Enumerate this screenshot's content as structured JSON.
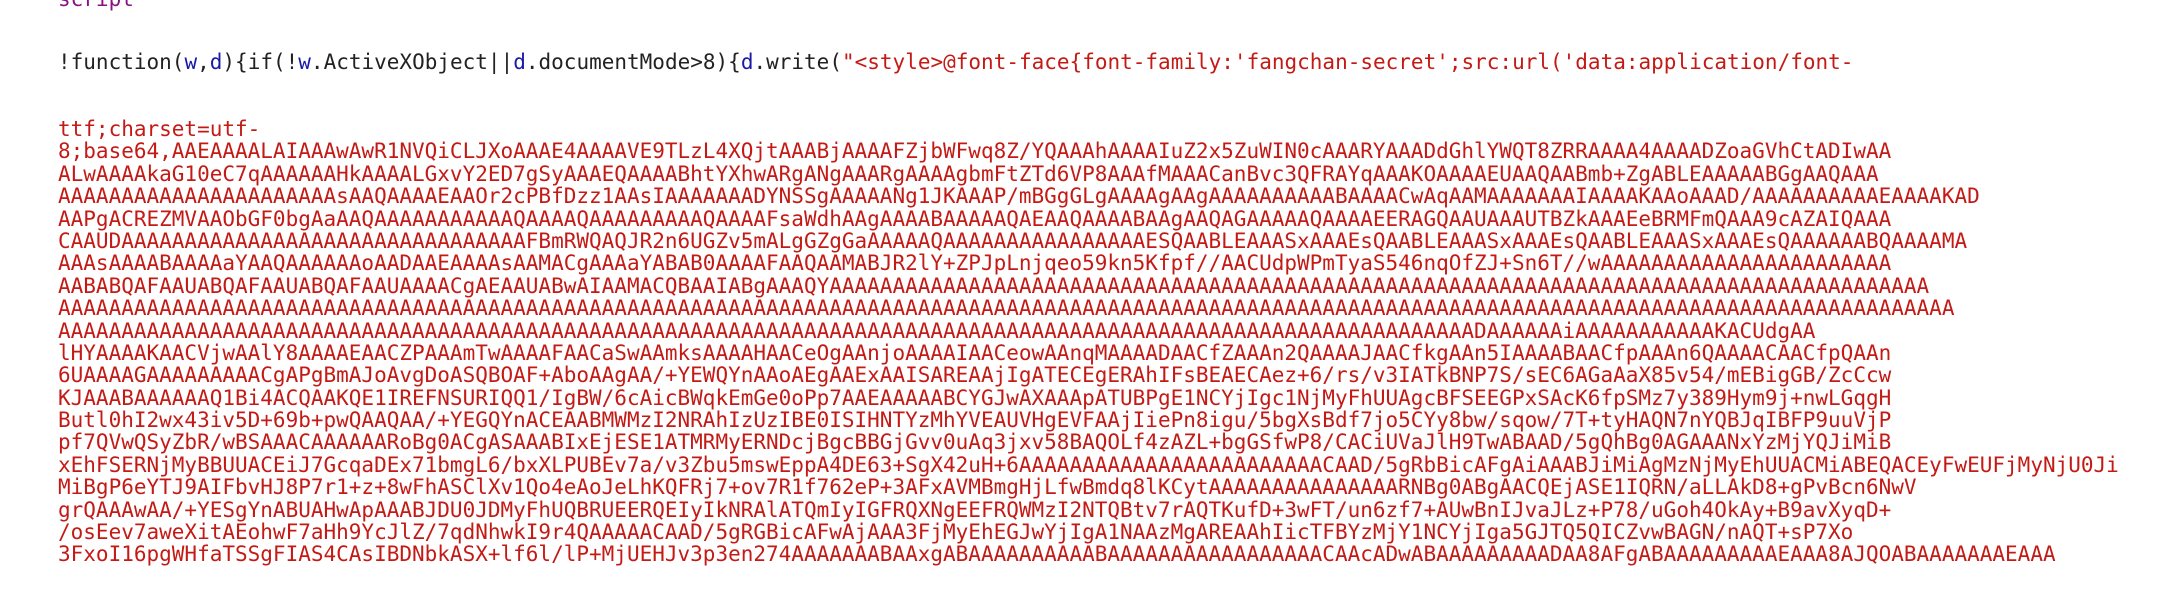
{
  "partial_tag": "script",
  "first_line": [
    {
      "text": "!function(",
      "cls": "punct"
    },
    {
      "text": "w",
      "cls": "ident"
    },
    {
      "text": ",",
      "cls": "punct"
    },
    {
      "text": "d",
      "cls": "ident"
    },
    {
      "text": "){if(!",
      "cls": "punct"
    },
    {
      "text": "w",
      "cls": "ident"
    },
    {
      "text": ".ActiveXObject||",
      "cls": "punct"
    },
    {
      "text": "d",
      "cls": "ident"
    },
    {
      "text": ".documentMode>8){",
      "cls": "punct"
    },
    {
      "text": "d",
      "cls": "ident"
    },
    {
      "text": ".write(",
      "cls": "punct"
    },
    {
      "text": "\"<style>@font-face{font-family:'fangchan-secret';src:url('data:application/font-",
      "cls": "str"
    }
  ],
  "string_lines": [
    "ttf;charset=utf-",
    "8;base64,AAEAAAALAIAAAwAwR1NVQiCLJXoAAAE4AAAAVE9TLzL4XQjtAAABjAAAAFZjbWFwq8Z/YQAAAhAAAAIuZ2x5ZuWIN0cAAARYAAADdGhlYWQT8ZRRAAAA4AAAADZoaGVhCtADIwAA",
    "ALwAAAAkaG10eC7qAAAAAAHkAAAALGxvY2ED7gSyAAAEQAAAABhtYXhwARgANgAAARgAAAAgbmFtZTd6VP8AAAfMAAACanBvc3QFRAYqAAAKOAAAAEUAAQAABmb+ZgABLEAAAAABGgAAQAAA",
    "AAAAAAAAAAAAAAAAAAAAAAsAAQAAAAEAAOr2cPBfDzz1AAsIAAAAAAADYNSSgAAAAANg1JKAAAP/mBGgGLgAAAAgAAgAAAAAAAAAABAAAACwAqAAMAAAAAAAIAAAAKAAoAAAD/AAAAAAAAAAEAAAAKAD",
    "AAPgACREZMVAAObGF0bgAaAAQAAAAAAAAAAAQAAAAQAAAAAAAAAQAAAAFsaWdhAAgAAAABAAAAAQAEAAQAAAABAAgAAQAGAAAAAQAAAAEERAGQAAUAAAUTBZkAAAEeBRMFmQAAA9cAZAIQAAA",
    "CAAUDAAAAAAAAAAAAAAAAAAAAAAAAAAAAAAAAFBmRWQAQJR2n6UGZv5mALgGZgGaAAAAAQAAAAAAAAAAAAAAAAESQAABLEAAASxAAAEsQAABLEAAASxAAAEsQAABLEAAASxAAAEsQAAAAAABQAAAAMA",
    "AAAsAAAABAAAAaYAAQAAAAAAoAADAAEAAAAsAAMACgAAAaYABAB0AAAAFAAQAAMABJR2lY+ZPJpLnjqeo59kn5Kfpf//AACUdpWPmTyaS546nqOfZJ+Sn6T//wAAAAAAAAAAAAAAAAAAAAAAA",
    "AABABQAFAAUABQAFAAUABQAFAAUAAAACgAEAAUABwAIAAMACQBAAIABgAAAQYAAAAAAAAAAAAAAAAAAAAAAAAAAAAAAAAAAAAAAAAAAAAAAAAAAAAAAAAAAAAAAAAAAAAAAAAAAAAAAAAAAAAAAA",
    "AAAAAAAAAAAAAAAAAAAAAAAAAAAAAAAAAAAAAAAAAAAAAAAAAAAAAAAAAAAAAAAAAAAAAAAAAAAAAAAAAAAAAAAAAAAAAAAAAAAAAAAAAAAAAAAAAAAAAAAAAAAAAAAAAAAAAAAAAAAAAAAAAAAAAA",
    "AAAAAAAAAAAAAAAAAAAAAAAAAAAAAAAAAAAAAAAAAAAAAAAAAAAAAAAAAAAAAAAAAAAAAAAAAAAAAAAAAAAAAAAAAAAAAAAAAAAAAAAAAAAAAAAADAAAAAAiAAAAAAAAAAAKACUdgAA",
    "lHYAAAAKAACVjwAAlY8AAAAEAACZPAAAmTwAAAAFAACaSwAAmksAAAAHAACeOgAAnjoAAAAIAACeowAAnqMAAAADAACfZAAAn2QAAAAJAACfkgAAn5IAAAABAACfpAAAn6QAAAACAACfpQAAn",
    "6UAAAAGAAAAAAAAACgAPgBmAJoAvgDoASQBOAF+AboAAgAA/+YEWQYnAAoAEgAAExAAISAREAAjIgATECEgERAhIFsBEAECAez+6/rs/v3IATkBNP7S/sEC6AGaAaX85v54/mEBigGB/ZcCcw",
    "KJAAABAAAAAAQ1Bi4ACQAAKQE1IREFNSURIQQ1/IgBW/6cAicBWqkEmGe0oPp7AAEAAAAABCYGJwAXAAApATUBPgE1NCYjIgc1NjMyFhUUAgcBFSEEGPxSAcK6fpSMz7y389Hym9j+nwLGqgH",
    "Butl0hI2wx43iv5D+69b+pwQAAQAA/+YEGQYnACEAABMWMzI2NRAhIzUzIBE0ISIHNTYzMhYVEAUVHgEVFAAjIiePn8igu/5bgXsBdf7jo5CYy8bw/sqow/7T+tyHAQN7nYQBJqIBFP9uuVjP",
    "pf7QVwQSyZbR/wBSAAACAAAAAARoBg0ACgASAAABIxEjESE1ATMRMyERNDcjBgcBBGjGvv0uAq3jxv58BAQOLf4zAZL+bgGSfwP8/CACiUVaJlH9TwABAAD/5gQhBg0AGAAANxYzMjYQJiMiB",
    "xEhFSERNjMyBBUUACEiJ7GcqaDEx71bmgL6/bxXLPUBEv7a/v3Zbu5mswEppA4DE63+SgX42uH+6AAAAAAAAAAAAAAAAAAAAAAAACAAD/5gRbBicAFgAiAAABJiMiAgMzNjMyEhUUACMiABEQACEyFwEUFjMyNjU0Ji",
    "MiBgP6eYTJ9AIFbvHJ8P7r1+z+8wFhASClXv1Qo4eAoJeLhKQFRj7+ov7R1f762eP+3AFxAVMBmgHjLfwBmdq8lKCytAAAAAAAAAAAAAAARNBg0ABgAACQEjASE1IQRN/aLLAkD8+gPvBcn6NwV",
    "grQAAAwAA/+YESgYnABUAHwApAAABJDU0JDMyFhUQBRUEERQEIyIkNRAlATQmIyIGFRQXNgEEFRQWMzI2NTQBtv7rAQTKufD+3wFT/un6zf7+AUwBnIJvaJLz+P78/uGoh4OkAy+B9avXyqD+",
    "/osEev7aweXitAEohwF7aHh9YcJlZ/7qdNhwkI9r4QAAAAACAAD/5gRGBicAFwAjAAA3FjMyEhEGJwYjIgA1NAAzMgAREAAhIicTFBYzMjY1NCYjIga5GJTQ5QICZvwBAGN/nAQT+sP7Xo",
    "3FxoI16pgWHfaTSSgFIAS4CAsIBDNbkASX+lf6l/lP+MjUEHJv3p3en274AAAAAAABAAxgABAAAAAAAAAABAAAAAAAAAAAAAAAAACAAcADwABAAAAAAAAADAA8AFgABAAAAAAAAAEAAA8AJQOABAAAAAAAEAAA"
  ]
}
